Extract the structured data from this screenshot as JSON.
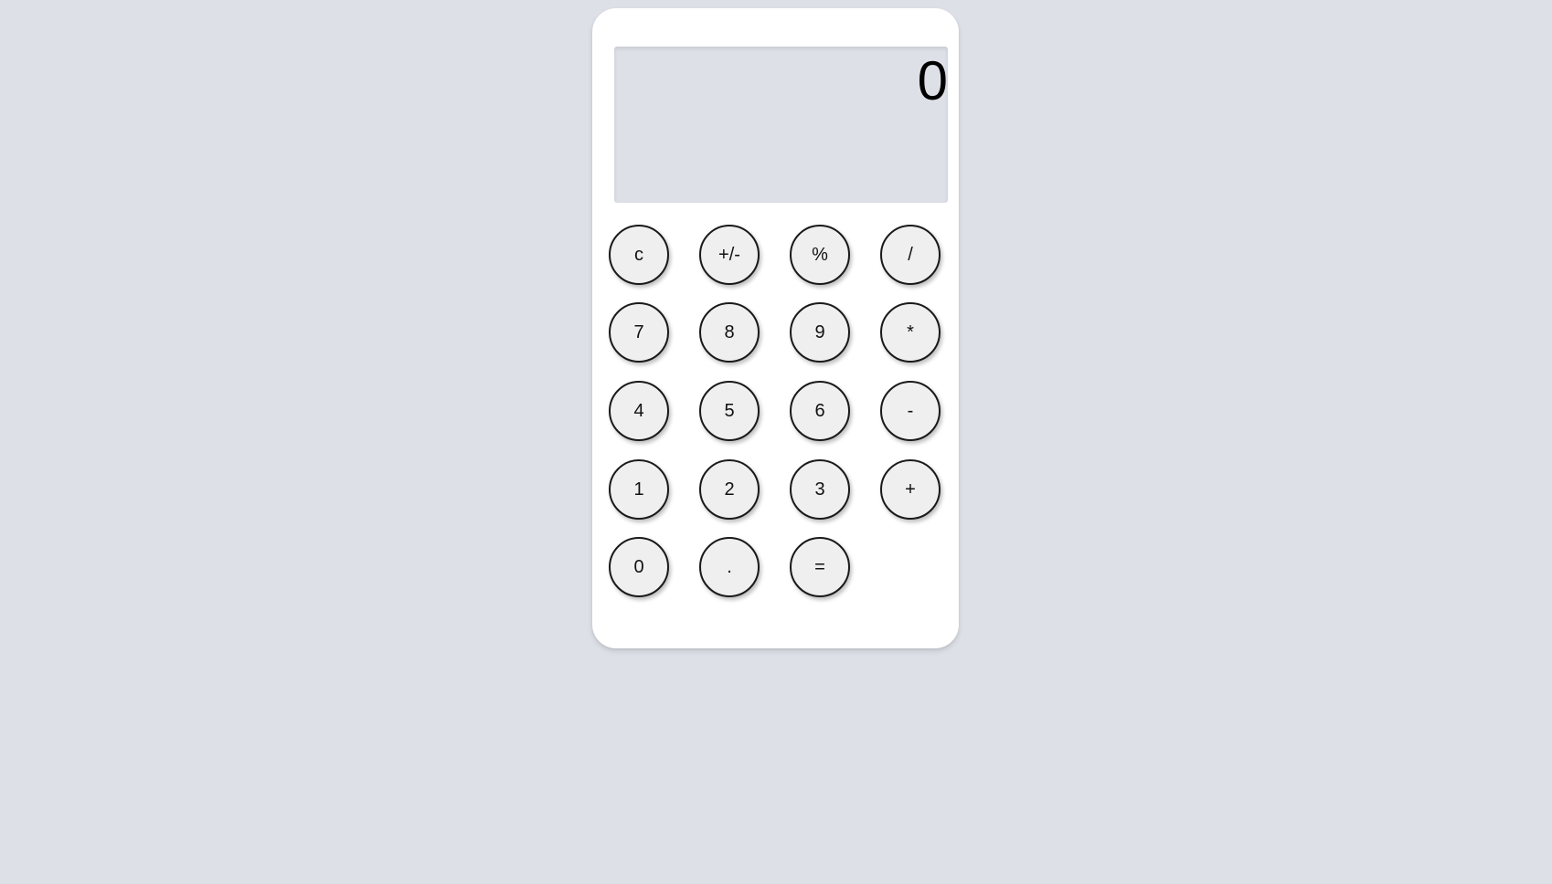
{
  "display": {
    "value": "0"
  },
  "keypad": {
    "rows": [
      [
        "c",
        "+/-",
        "%",
        "/"
      ],
      [
        "7",
        "8",
        "9",
        "*"
      ],
      [
        "4",
        "5",
        "6",
        "-"
      ],
      [
        "1",
        "2",
        "3",
        "+"
      ],
      [
        "0",
        ".",
        "="
      ]
    ]
  },
  "colors": {
    "page_background": "#dde0e7",
    "calculator_body": "#ffffff",
    "display_background": "#dde0e7",
    "button_fill": "#efefef",
    "button_border": "#1a1a1a",
    "text": "#000000"
  }
}
